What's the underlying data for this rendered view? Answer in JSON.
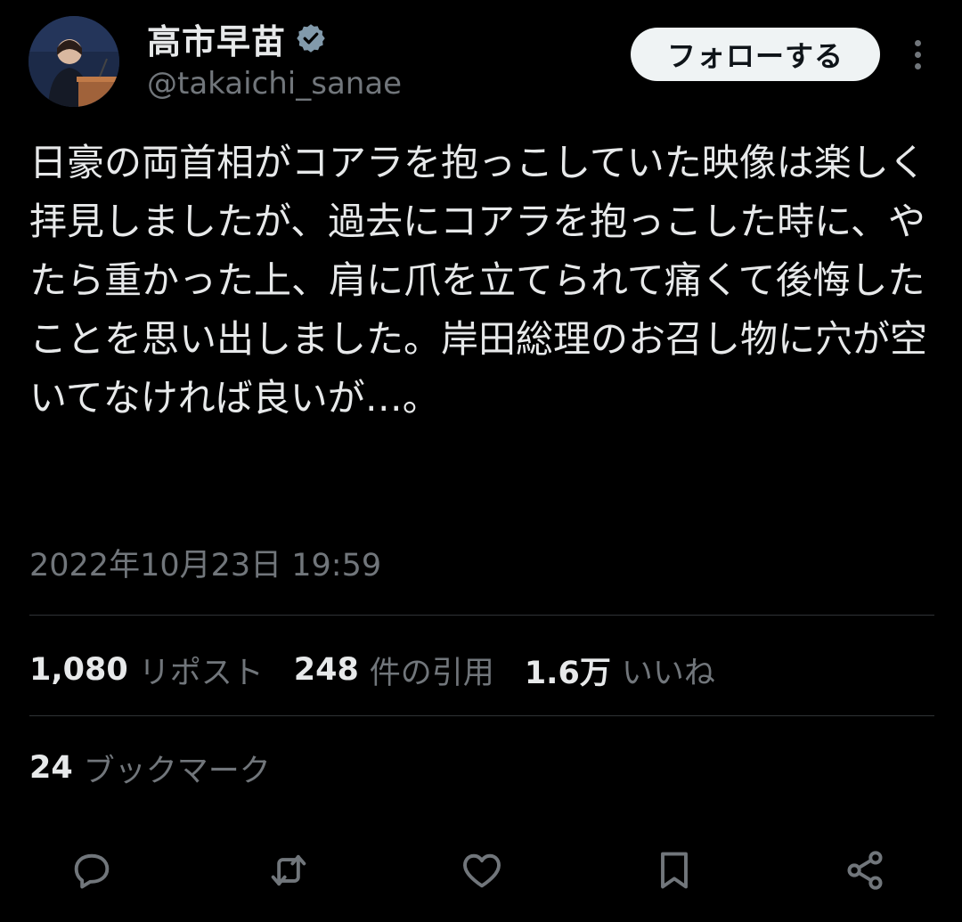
{
  "header": {
    "display_name": "高市早苗",
    "handle": "@takaichi_sanae",
    "follow_label": "フォローする",
    "verified_icon": "verified-badge-icon",
    "more_icon": "more-vertical-icon"
  },
  "tweet": {
    "text": "日豪の両首相がコアラを抱っこしていた映像は楽しく拝見しましたが、過去にコアラを抱っこした時に、やたら重かった上、肩に爪を立てられて痛くて後悔したことを思い出しました。岸田総理のお召し物に穴が空いてなければ良いが…。",
    "timestamp": "2022年10月23日 19:59"
  },
  "stats": {
    "reposts": {
      "count": "1,080",
      "label": "リポスト"
    },
    "quotes": {
      "count": "248",
      "label": "件の引用"
    },
    "likes": {
      "count": "1.6万",
      "label": "いいね"
    },
    "bookmarks": {
      "count": "24",
      "label": "ブックマーク"
    }
  },
  "actions": [
    "reply-icon",
    "repost-icon",
    "like-icon",
    "bookmark-icon",
    "share-icon"
  ],
  "colors": {
    "background": "#000000",
    "text_primary": "#e7e9ea",
    "text_secondary": "#71767b",
    "divider": "#2f3336",
    "follow_button_bg": "#eff3f4"
  }
}
